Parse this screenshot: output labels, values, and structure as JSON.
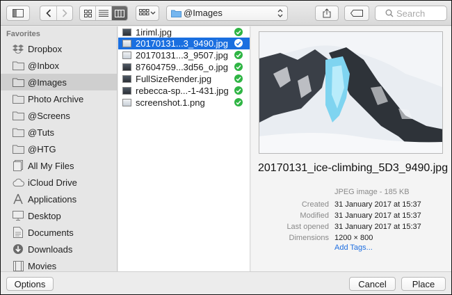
{
  "toolbar": {
    "path_popup": "@Images",
    "search": {
      "placeholder": "Search",
      "value": ""
    }
  },
  "sidebar": {
    "heading": "Favorites",
    "items": [
      {
        "label": "Dropbox",
        "icon": "dropbox-icon"
      },
      {
        "label": "@Inbox",
        "icon": "folder-icon"
      },
      {
        "label": "@Images",
        "icon": "folder-icon",
        "selected": true
      },
      {
        "label": "Photo Archive",
        "icon": "folder-icon"
      },
      {
        "label": "@Screens",
        "icon": "folder-icon"
      },
      {
        "label": "@Tuts",
        "icon": "folder-icon"
      },
      {
        "label": "@HTG",
        "icon": "folder-icon"
      },
      {
        "label": "All My Files",
        "icon": "all-files-icon"
      },
      {
        "label": "iCloud Drive",
        "icon": "cloud-icon"
      },
      {
        "label": "Applications",
        "icon": "applications-icon"
      },
      {
        "label": "Desktop",
        "icon": "desktop-icon"
      },
      {
        "label": "Documents",
        "icon": "documents-icon"
      },
      {
        "label": "Downloads",
        "icon": "downloads-icon"
      },
      {
        "label": "Movies",
        "icon": "movies-icon"
      }
    ]
  },
  "files": [
    {
      "name": "1iriml.jpg",
      "selected": false
    },
    {
      "name": "20170131...3_9490.jpg",
      "selected": true
    },
    {
      "name": "20170131...3_9507.jpg",
      "selected": false
    },
    {
      "name": "87604759...3d56_o.jpg",
      "selected": false
    },
    {
      "name": "FullSizeRender.jpg",
      "selected": false
    },
    {
      "name": "rebecca-sp...-1-431.jpg",
      "selected": false
    },
    {
      "name": "screenshot.1.png",
      "selected": false
    }
  ],
  "preview": {
    "title": "20170131_ice-climbing_5D3_9490.jpg",
    "kind": "JPEG image - 185 KB",
    "info": [
      {
        "label": "Created",
        "value": "31 January 2017 at 15:37"
      },
      {
        "label": "Modified",
        "value": "31 January 2017 at 15:37"
      },
      {
        "label": "Last opened",
        "value": "31 January 2017 at 15:37"
      },
      {
        "label": "Dimensions",
        "value": "1200 × 800"
      }
    ],
    "add_tags": "Add Tags..."
  },
  "buttons": {
    "options": "Options",
    "cancel": "Cancel",
    "place": "Place"
  },
  "colors": {
    "selection": "#1a6fe0",
    "check": "#2fb544",
    "link": "#1f6fe0"
  }
}
